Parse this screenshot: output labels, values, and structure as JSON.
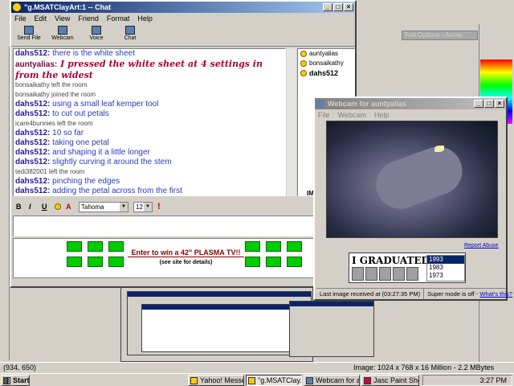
{
  "chat_window": {
    "title": "\"g.MSATClayArt:1 -- Chat",
    "menu": [
      "File",
      "Edit",
      "View",
      "Friend",
      "Format",
      "Help"
    ],
    "toolbar": [
      {
        "label": "Send File",
        "icon": "send-file-icon"
      },
      {
        "label": "Webcam",
        "icon": "webcam-icon"
      },
      {
        "label": "Voice",
        "icon": "voice-icon"
      },
      {
        "label": "Chat",
        "icon": "chat-icon"
      }
    ],
    "messages": [
      {
        "who": "dahs512:",
        "text": "there is the white sheet",
        "kind": "normal"
      },
      {
        "who": "auntyalias:",
        "text": "I pressed the white sheet at 4 settings in from the widest",
        "kind": "big"
      },
      {
        "who": "bonsaikathy",
        "text": "left the room",
        "kind": "sys"
      },
      {
        "who": "bonsaikathy",
        "text": "joined the room",
        "kind": "sys"
      },
      {
        "who": "dahs512:",
        "text": "using a small leaf kemper tool",
        "kind": "normal"
      },
      {
        "who": "dahs512:",
        "text": "to cut out petals",
        "kind": "normal"
      },
      {
        "who": "icare4bunnies",
        "text": "left the room",
        "kind": "sys"
      },
      {
        "who": "dahs512:",
        "text": "10 so far",
        "kind": "normal"
      },
      {
        "who": "dahs512:",
        "text": "taking one petal",
        "kind": "normal"
      },
      {
        "who": "dahs512:",
        "text": "and shaping it a little longer",
        "kind": "normal"
      },
      {
        "who": "dahs512:",
        "text": "slightly curving it around the stem",
        "kind": "normal"
      },
      {
        "who": "tedi382001",
        "text": "left the room",
        "kind": "sys"
      },
      {
        "who": "dahs512:",
        "text": "pinching the edges",
        "kind": "normal"
      },
      {
        "who": "dahs512:",
        "text": "adding the petal across from the first",
        "kind": "normal"
      }
    ],
    "users": [
      {
        "name": "auntyalias",
        "bold": false
      },
      {
        "name": "bonsaikathy",
        "bold": false
      },
      {
        "name": "dahs512",
        "bold": true
      }
    ],
    "im_label": "IM",
    "format_bar": {
      "bold": "B",
      "italic": "I",
      "underline": "U",
      "font": "Tahoma",
      "size": "12"
    },
    "input_value": "",
    "ad": {
      "headline": "Enter to win a 42\" PLASMA TV!!",
      "sub": "(see site for details)"
    }
  },
  "webcam_window": {
    "title": "Webcam for auntyalias",
    "menu": [
      "File",
      "Webcam",
      "Help"
    ],
    "report_label": "Report Abuse",
    "ad_headline": "I GRADUATED IN:",
    "years": [
      "1993",
      "1983",
      "1973"
    ],
    "status": [
      "Last image received at (03:27:35 PM)",
      "Super mode is off -"
    ],
    "whats_this": "What's this?"
  },
  "paint_shop": {
    "tool_options_title": "Tool Options - Arrow",
    "coords": "(934, 650)",
    "image_info": "Image: 1024 x 768 x 16 Million - 2.2 MBytes"
  },
  "taskbar": {
    "start": "Start",
    "buttons": [
      {
        "label": "Yahoo! Messen...",
        "active": false
      },
      {
        "label": "\"g.MSATClay...",
        "active": true
      },
      {
        "label": "Webcam for au...",
        "active": false
      },
      {
        "label": "Jasc Paint Shop...",
        "active": false
      }
    ],
    "clock": "3:27 PM"
  }
}
